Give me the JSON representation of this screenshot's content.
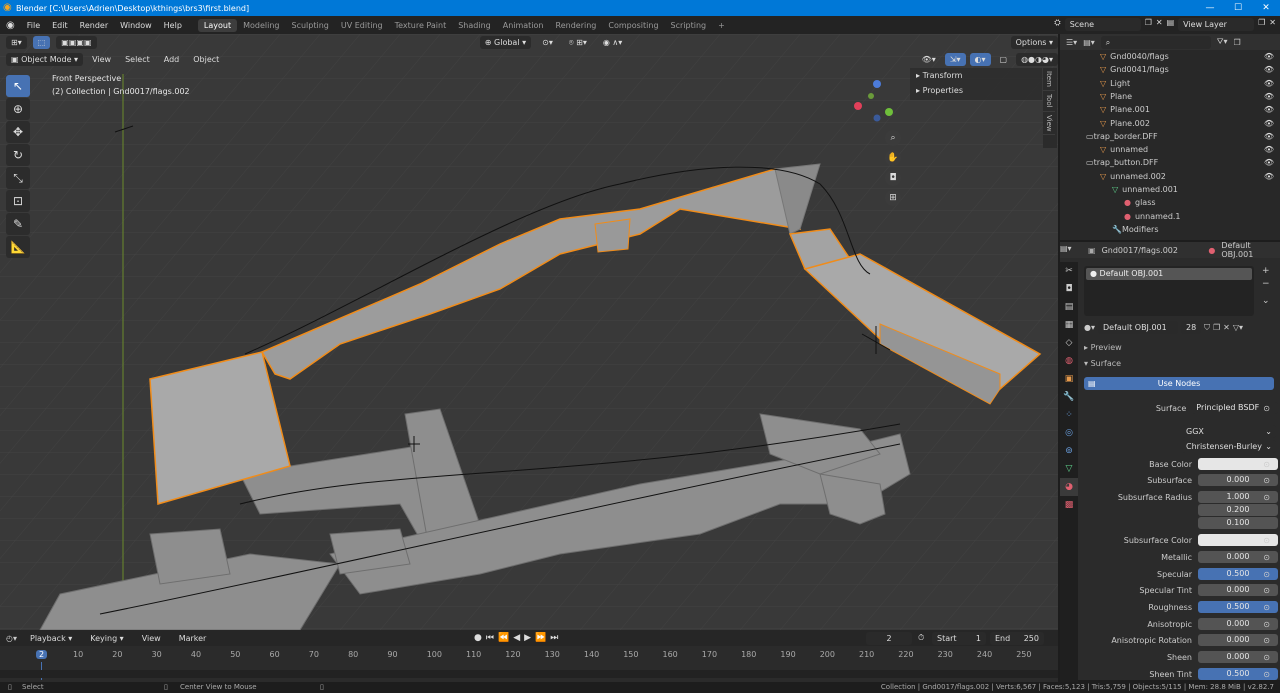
{
  "window": {
    "title": "Blender [C:\\Users\\Adrien\\Desktop\\kthings\\brs3\\first.blend]"
  },
  "menu": [
    "File",
    "Edit",
    "Render",
    "Window",
    "Help"
  ],
  "workspaces": [
    "Layout",
    "Modeling",
    "Sculpting",
    "UV Editing",
    "Texture Paint",
    "Shading",
    "Animation",
    "Rendering",
    "Compositing",
    "Scripting"
  ],
  "top_right": {
    "scene": "Scene",
    "view_layer": "View Layer"
  },
  "viewport": {
    "transform_orientation": "Global",
    "options_label": "Options",
    "mode": "Object Mode",
    "header_menus": [
      "View",
      "Select",
      "Add",
      "Object"
    ],
    "overlay_title": "Front Perspective",
    "overlay_sub": "(2) Collection | Gnd0017/flags.002",
    "npanel": [
      "Transform",
      "Properties"
    ],
    "ntabs": [
      "Item",
      "Tool",
      "View"
    ]
  },
  "outliner": {
    "search_placeholder": "",
    "rows": [
      {
        "label": "Gnd0040/flags",
        "kind": "obj"
      },
      {
        "label": "Gnd0041/flags",
        "kind": "obj"
      },
      {
        "label": "Light",
        "kind": "obj"
      },
      {
        "label": "Plane",
        "kind": "obj"
      },
      {
        "label": "Plane.001",
        "kind": "obj"
      },
      {
        "label": "Plane.002",
        "kind": "obj"
      },
      {
        "label": "trap_border.DFF",
        "kind": "col"
      },
      {
        "label": "unnamed",
        "kind": "obj"
      },
      {
        "label": "trap_button.DFF",
        "kind": "col"
      },
      {
        "label": "unnamed.002",
        "kind": "obj"
      },
      {
        "label": "unnamed.001",
        "kind": "mesh"
      },
      {
        "label": "glass",
        "kind": "mat"
      },
      {
        "label": "unnamed.1",
        "kind": "mat"
      },
      {
        "label": "Modifiers",
        "kind": "mod"
      }
    ]
  },
  "properties": {
    "object_name": "Gnd0017/flags.002",
    "material_name": "Default OBJ.001",
    "slot": "Default OBJ.001",
    "material_field": "Default OBJ.001",
    "users": "28",
    "preview_label": "Preview",
    "surface_label": "Surface",
    "use_nodes": "Use Nodes",
    "surface": "Principled BSDF",
    "distribution": "GGX",
    "sss_method": "Christensen-Burley",
    "fields": [
      {
        "label": "Base Color",
        "value": "",
        "style": "white"
      },
      {
        "label": "Subsurface",
        "value": "0.000",
        "style": ""
      },
      {
        "label": "Subsurface Radius",
        "value": "1.000",
        "style": ""
      },
      {
        "label": "",
        "value": "0.200",
        "style": ""
      },
      {
        "label": "",
        "value": "0.100",
        "style": ""
      },
      {
        "label": "Subsurface Color",
        "value": "",
        "style": "white"
      },
      {
        "label": "Metallic",
        "value": "0.000",
        "style": ""
      },
      {
        "label": "Specular",
        "value": "0.500",
        "style": "blue"
      },
      {
        "label": "Specular Tint",
        "value": "0.000",
        "style": ""
      },
      {
        "label": "Roughness",
        "value": "0.500",
        "style": "blue"
      },
      {
        "label": "Anisotropic",
        "value": "0.000",
        "style": ""
      },
      {
        "label": "Anisotropic Rotation",
        "value": "0.000",
        "style": ""
      },
      {
        "label": "Sheen",
        "value": "0.000",
        "style": ""
      },
      {
        "label": "Sheen Tint",
        "value": "0.500",
        "style": "blue"
      }
    ]
  },
  "timeline": {
    "menus": [
      "Playback",
      "Keying",
      "View",
      "Marker"
    ],
    "current_frame": "2",
    "start_label": "Start",
    "start": "1",
    "end_label": "End",
    "end": "250",
    "ruler": [
      "2",
      "10",
      "20",
      "30",
      "40",
      "50",
      "60",
      "70",
      "80",
      "90",
      "100",
      "110",
      "120",
      "130",
      "140",
      "150",
      "160",
      "170",
      "180",
      "190",
      "200",
      "210",
      "220",
      "230",
      "240",
      "250"
    ]
  },
  "status": {
    "left": "Select",
    "middle": "Center View to Mouse",
    "right": "Collection | Gnd0017/flags.002 | Verts:6,567 | Faces:5,123 | Tris:5,759 | Objects:5/115 | Mem: 28.8 MiB | v2.82.7"
  }
}
